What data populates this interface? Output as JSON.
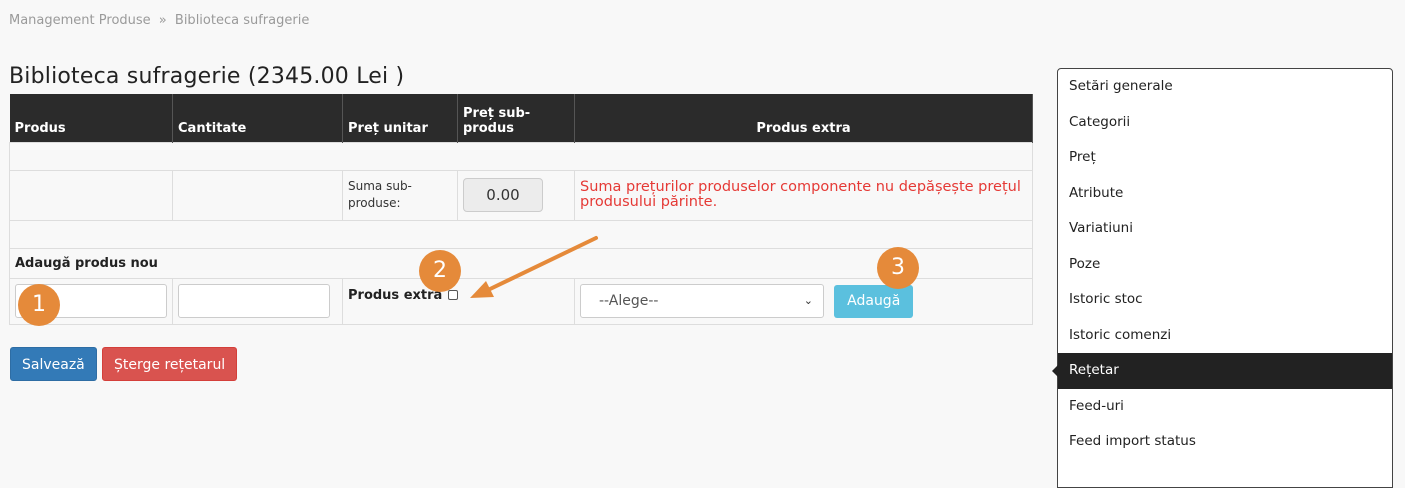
{
  "breadcrumb": {
    "root": "Management Produse",
    "separator": "»",
    "current": "Biblioteca sufragerie"
  },
  "page_title": "Biblioteca sufragerie (2345.00 Lei )",
  "table": {
    "headers": [
      "Produs",
      "Cantitate",
      "Preț unitar",
      "Preț sub-produs",
      "Produs extra"
    ],
    "sum_label": "Suma sub-produse:",
    "sum_value": "0.00",
    "warning": "Suma prețurilor produselor componente nu depășește prețul produsului părinte.",
    "add_section_title": "Adaugă produs nou",
    "product_input_value": "",
    "quantity_input_value": "",
    "extra_label": "Produs extra",
    "extra_checked": false,
    "select_value": "--Alege--",
    "add_button": "Adaugă"
  },
  "actions": {
    "save": "Salvează",
    "delete": "Șterge rețetarul"
  },
  "annotations": [
    "1",
    "2",
    "3"
  ],
  "sidebar": {
    "items": [
      {
        "label": "Setări generale",
        "active": false
      },
      {
        "label": "Categorii",
        "active": false
      },
      {
        "label": "Preț",
        "active": false
      },
      {
        "label": "Atribute",
        "active": false
      },
      {
        "label": "Variatiuni",
        "active": false
      },
      {
        "label": "Poze",
        "active": false
      },
      {
        "label": "Istoric stoc",
        "active": false
      },
      {
        "label": "Istoric comenzi",
        "active": false
      },
      {
        "label": "Rețetar",
        "active": true
      },
      {
        "label": "Feed-uri",
        "active": false
      },
      {
        "label": "Feed import status",
        "active": false
      }
    ]
  },
  "colors": {
    "header_bg": "#2b2b2b",
    "warning": "#e53935",
    "primary": "#337ab7",
    "danger": "#d9534f",
    "info": "#5bc0de",
    "annotation": "#e58a3a"
  }
}
